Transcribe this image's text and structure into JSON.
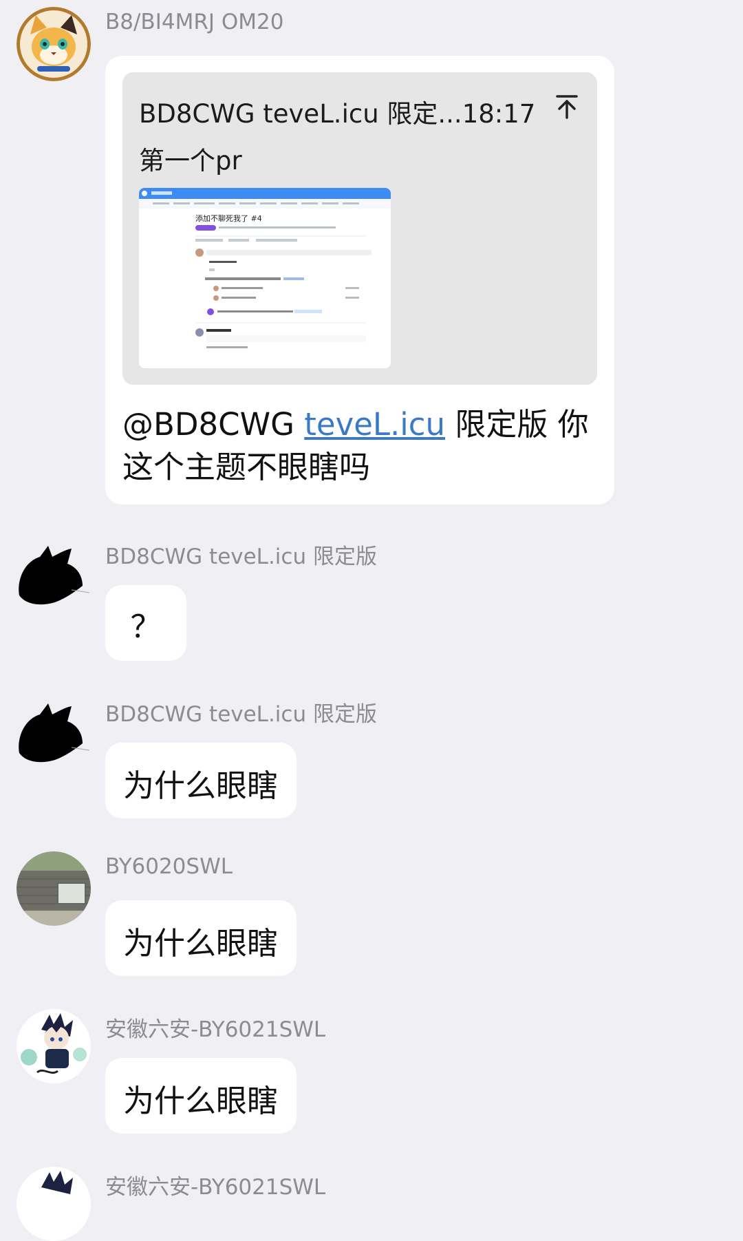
{
  "messages": [
    {
      "sender": "B8/BI4MRJ OM20",
      "avatar": "fox-avatar-icon",
      "quote": {
        "title": "BD8CWG teveL.icu 限定...18:17",
        "body": "第一个pr",
        "thumb_title": "添加不聊死我了 #4",
        "up_icon": "scroll-to-top-icon"
      },
      "text_prefix": "@BD8CWG ",
      "link": "teveL.icu",
      "text_suffix": " 限定版 你这个主题不眼瞎吗"
    },
    {
      "sender": "BD8CWG teveL.icu 限定版",
      "avatar": "black-cat-icon",
      "text": "？"
    },
    {
      "sender": "BD8CWG teveL.icu 限定版",
      "avatar": "black-cat-icon",
      "text": "为什么眼瞎"
    },
    {
      "sender": "BY6020SWL",
      "avatar": "stone-gate-photo-icon",
      "text": "为什么眼瞎"
    },
    {
      "sender": "安徽六安-BY6021SWL",
      "avatar": "anime-character-icon",
      "text": "为什么眼瞎"
    },
    {
      "sender": "安徽六安-BY6021SWL",
      "avatar": "anime-character-icon"
    }
  ],
  "colors": {
    "background": "#efeff4",
    "bubble": "#ffffff",
    "sender_text": "#8b8b91",
    "link": "#3a78c9"
  }
}
